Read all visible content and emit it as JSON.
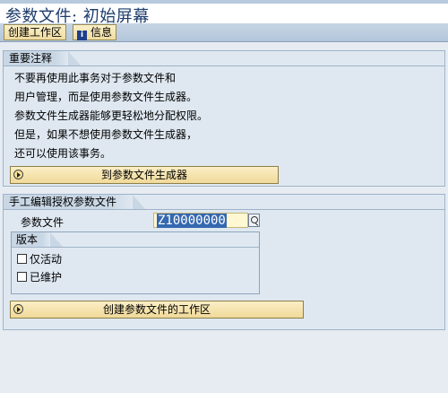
{
  "window": {
    "title": "参数文件: 初始屏幕"
  },
  "toolbar": {
    "create_worklist_label": "创建工作区",
    "info_label": "信息",
    "info_icon": "info-icon"
  },
  "notes_group": {
    "title": "重要注释",
    "lines": [
      "不要再使用此事务对于参数文件和",
      "用户管理，而是使用参数文件生成器。",
      "参数文件生成器能够更轻松地分配权限。",
      "但是，如果不想使用参数文件生成器，",
      "还可以使用该事务。"
    ],
    "button_label": "到参数文件生成器"
  },
  "manual_group": {
    "title": "手工编辑授权参数文件",
    "profile_label": "参数文件",
    "profile_value": "Z10000000",
    "version": {
      "title": "版本",
      "only_active_label": "仅活动",
      "maintained_label": "已维护"
    },
    "create_button_label": "创建参数文件的工作区"
  },
  "colors": {
    "title_text": "#1d3d6b",
    "button_fill": "#f0d999",
    "background": "#e6ecf2",
    "selection": "#3468b0"
  }
}
